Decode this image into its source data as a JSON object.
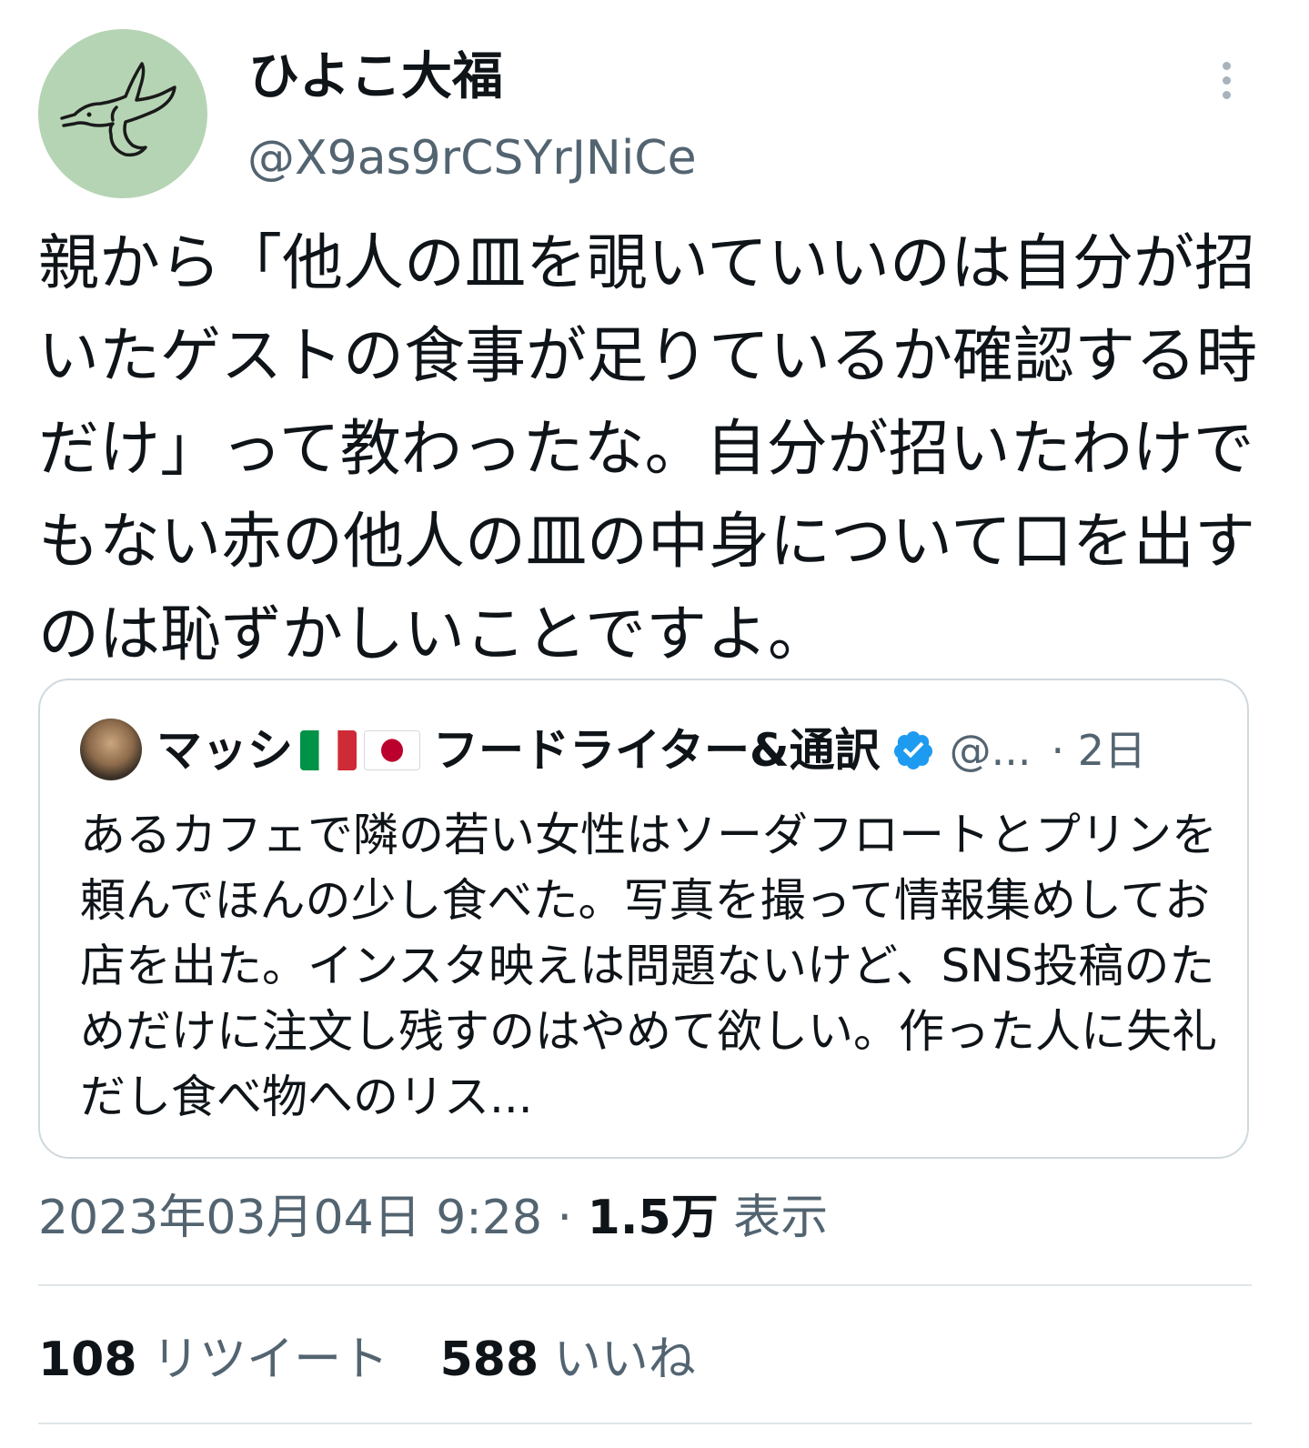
{
  "author": {
    "display_name": "ひよこ大福",
    "handle": "@X9as9rCSYrJNiCe",
    "avatar_icon": "bird-drawing-icon"
  },
  "tweet": {
    "text": "親から「他人の皿を覗いていいのは自分が招いたゲストの食事が足りているか確認する時だけ」って教わったな。自分が招いたわけでもない赤の他人の皿の中身について口を出すのは恥ずかしいことですよ。"
  },
  "quote": {
    "name": "マッシ",
    "flags": [
      "italy-flag-icon",
      "japan-flag-icon"
    ],
    "name_suffix": "フードライター&通訳",
    "handle": "@...",
    "time": "· 2日",
    "text": "あるカフェで隣の若い女性はソーダフロートとプリンを頼んでほんの少し食べた。写真を撮って情報集めしてお店を出た。インスタ映えは問題ないけど、SNS投稿のためだけに注文し残すのはやめて欲しい。作った人に失礼だし食べ物へのリス..."
  },
  "meta": {
    "timestamp": "2023年03月04日 9:28",
    "separator": "·",
    "views_count": "1.5万",
    "views_label": "表示"
  },
  "stats": {
    "retweets_count": "108",
    "retweets_label": "リツイート",
    "likes_count": "588",
    "likes_label": "いいね"
  },
  "colors": {
    "text": "#0f1419",
    "secondary": "#536471",
    "border": "#cfd9de",
    "verified": "#1d9bf0",
    "avatar_bg": "#b5d4b4"
  }
}
